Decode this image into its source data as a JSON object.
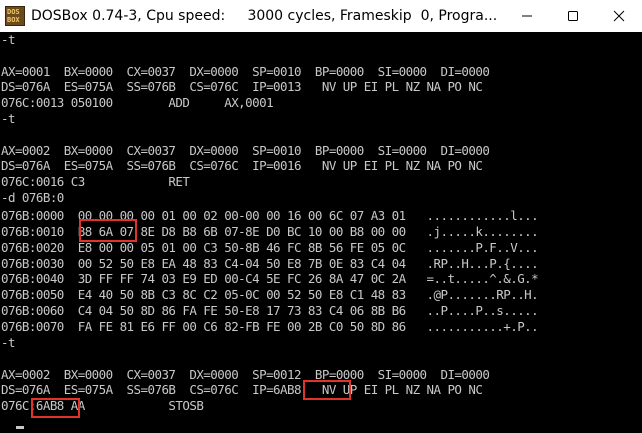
{
  "window": {
    "title": "DOSBox 0.74-3, Cpu speed:     3000 cycles, Frameskip  0, Progra..."
  },
  "console": {
    "lines": [
      "-t",
      "",
      "AX=0001  BX=0000  CX=0037  DX=0000  SP=0010  BP=0000  SI=0000  DI=0000",
      "DS=076A  ES=075A  SS=076B  CS=076C  IP=0013   NV UP EI PL NZ NA PO NC",
      "076C:0013 050100        ADD     AX,0001",
      "-t",
      "",
      "AX=0002  BX=0000  CX=0037  DX=0000  SP=0010  BP=0000  SI=0000  DI=0000",
      "DS=076A  ES=075A  SS=076B  CS=076C  IP=0016   NV UP EI PL NZ NA PO NC",
      "076C:0016 C3            RET",
      "-d 076B:0",
      "076B:0000  00 00 00 00 01 00 02 00-00 00 16 00 6C 07 A3 01   ............l...",
      "076B:0010  B8 6A 07 8E D8 B8 6B 07-8E D0 BC 10 00 B8 00 00   .j.....k........",
      "076B:0020  E8 00 00 05 01 00 C3 50-8B 46 FC 8B 56 FE 05 0C   .......P.F..V...",
      "076B:0030  00 52 50 E8 EA 48 83 C4-04 50 E8 7B 0E 83 C4 04   .RP..H...P.{....",
      "076B:0040  3D FF FF 74 03 E9 ED 00-C4 5E FC 26 8A 47 0C 2A   =..t.....^.&.G.*",
      "076B:0050  E4 40 50 8B C3 8C C2 05-0C 00 52 50 E8 C1 48 83   .@P.......RP..H.",
      "076B:0060  C4 04 50 8D 86 FA FE 50-E8 17 73 83 C4 06 8B B6   ..P....P..s.....",
      "076B:0070  FA FE 81 E6 FF 00 C6 82-FB FE 00 2B C0 50 8D 86   ...........+.P..",
      "-t",
      "",
      "AX=0002  BX=0000  CX=0037  DX=0000  SP=0012  BP=0000  SI=0000  DI=0000",
      "DS=076A  ES=075A  SS=076B  CS=076C  IP=6AB8   NV UP EI PL NZ NA PO NC",
      "076C:6AB8 AA            STOSB",
      ""
    ],
    "highlights": [
      {
        "label": "B8 6A"
      },
      {
        "label": "6AB8"
      },
      {
        "label": "6AB8"
      }
    ]
  },
  "colors": {
    "background": "#000000",
    "text": "#c8c8c8",
    "highlight_border": "#e0332c",
    "titlebar": "#ffffff"
  }
}
